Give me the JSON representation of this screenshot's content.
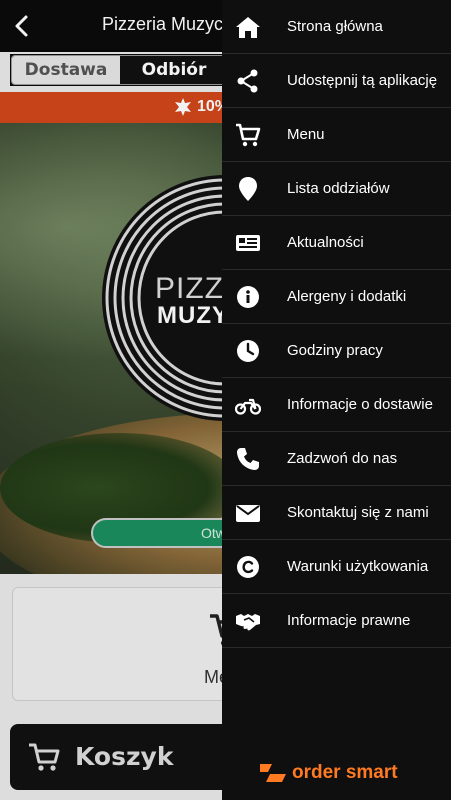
{
  "header": {
    "title": "Pizzeria Muzycz"
  },
  "order_mode": {
    "options": [
      "Dostawa",
      "Odbiór"
    ],
    "selected": "Odbiór"
  },
  "promo": {
    "text": "10%"
  },
  "hero": {
    "logo_line1": "PIZZE",
    "logo_line2": "MUZY",
    "status_pill": "Otw"
  },
  "menu_card": {
    "label": "Me"
  },
  "cart": {
    "label": "Koszyk"
  },
  "drawer": {
    "items": [
      {
        "label": "Strona główna",
        "icon": "home-icon"
      },
      {
        "label": "Udostępnij tą aplikację",
        "icon": "share-icon"
      },
      {
        "label": "Menu",
        "icon": "cart-icon"
      },
      {
        "label": "Lista oddziałów",
        "icon": "location-pin-icon"
      },
      {
        "label": "Aktualności",
        "icon": "news-icon"
      },
      {
        "label": "Alergeny i dodatki",
        "icon": "info-icon"
      },
      {
        "label": "Godziny pracy",
        "icon": "clock-icon"
      },
      {
        "label": "Informacje o dostawie",
        "icon": "motorcycle-icon"
      },
      {
        "label": "Zadzwoń do nas",
        "icon": "phone-icon"
      },
      {
        "label": "Skontaktuj się z nami",
        "icon": "envelope-icon"
      },
      {
        "label": "Warunki użytkowania",
        "icon": "copyright-icon"
      },
      {
        "label": "Informacje prawne",
        "icon": "handshake-icon"
      }
    ]
  },
  "brand": {
    "text": "order smart"
  },
  "colors": {
    "promo_bar": "#d1461b",
    "open_pill": "#1c8f5f",
    "brand": "#ff7a21",
    "drawer_bg": "#0f0f0f"
  }
}
